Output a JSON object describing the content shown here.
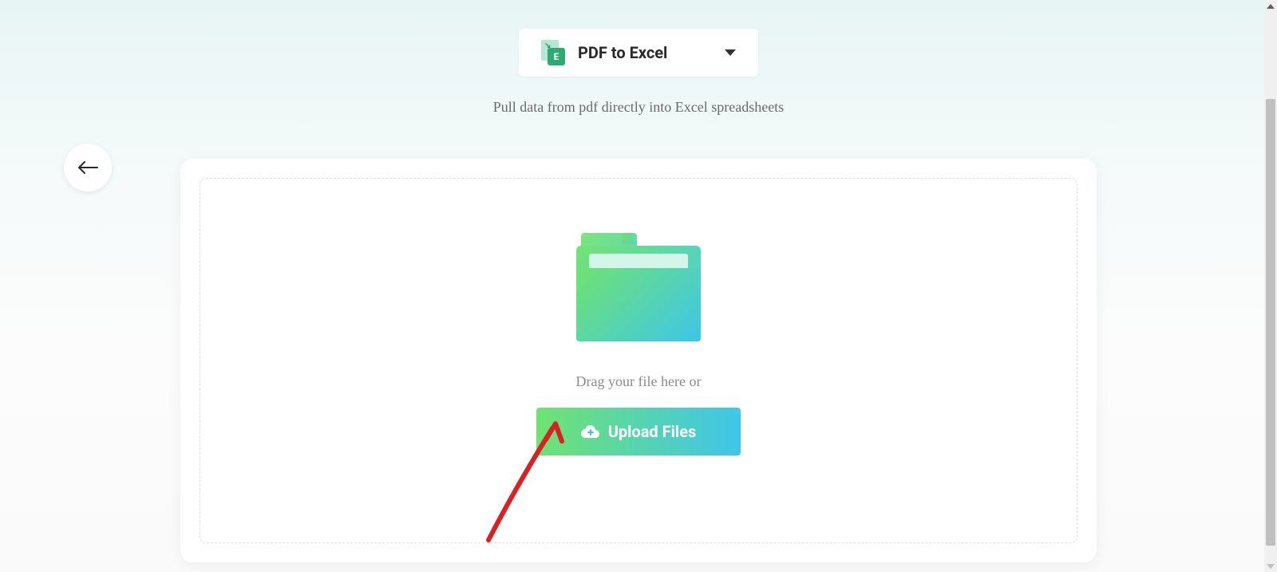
{
  "tool": {
    "label": "PDF to Excel",
    "icon_letter": "E"
  },
  "description": "Pull data from pdf directly into Excel spreadsheets",
  "upload": {
    "drag_text": "Drag your file here or",
    "button_label": "Upload Files"
  }
}
